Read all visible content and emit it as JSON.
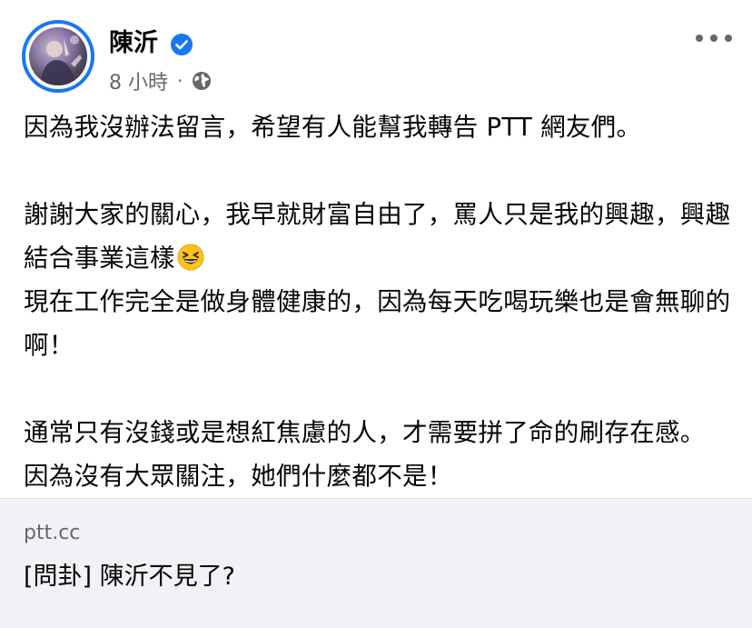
{
  "post": {
    "author": "陳沂",
    "time": "8 小時",
    "separator": "·",
    "privacy_icon": "globe-icon",
    "verified_icon": "verified-badge-icon",
    "more_icon": "more-options-icon",
    "body": {
      "p1": "因為我沒辦法留言，希望有人能幫我轉告 PTT 網友們。",
      "p2_line1": "謝謝大家的關心，我早就財富自由了，罵人只是我的興趣，興趣結合事業這樣",
      "p2_emoji": "grinning-squinting-face-icon",
      "p2_line2": "現在工作完全是做身體健康的，因為每天吃喝玩樂也是會無聊的啊！",
      "p3_line1": "通常只有沒錢或是想紅焦慮的人，才需要拼了命的刷存在感。",
      "p3_line2": "因為沒有大眾關注，她們什麼都不是！"
    }
  },
  "link_preview": {
    "domain": "ptt.cc",
    "title": "[問卦] 陳沂不見了?"
  },
  "colors": {
    "accent": "#1877f2",
    "secondary_text": "#65676b",
    "preview_bg": "#f0f2f5"
  }
}
